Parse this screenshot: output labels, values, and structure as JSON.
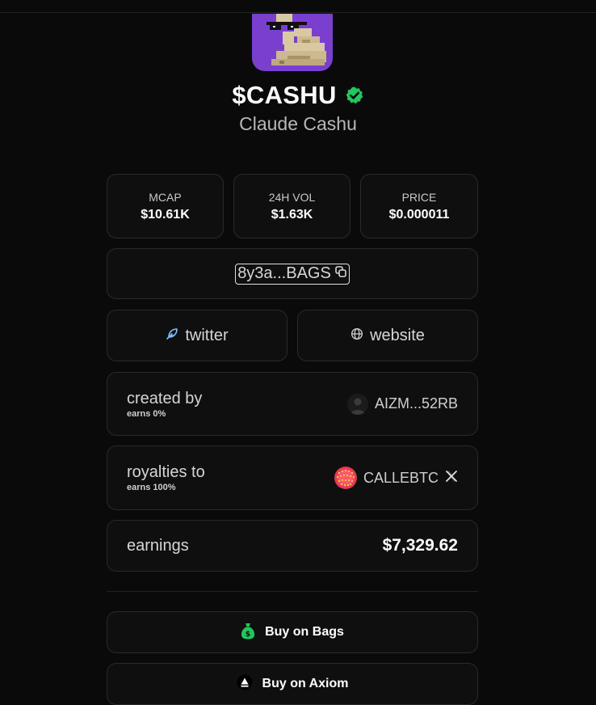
{
  "token": {
    "ticker": "$CASHU",
    "name": "Claude Cashu",
    "logo_bg": "#7b3fd0",
    "verified_color": "#22c55e"
  },
  "stats": [
    {
      "label": "MCAP",
      "value": "$10.61K"
    },
    {
      "label": "24H VOL",
      "value": "$1.63K"
    },
    {
      "label": "PRICE",
      "value": "$0.000011"
    }
  ],
  "contract": {
    "address_short": "8y3a...BAGS",
    "copy_icon": "copy-icon"
  },
  "links": {
    "twitter_label": "twitter",
    "twitter_icon": "feather-icon",
    "website_label": "website",
    "website_icon": "globe-icon"
  },
  "creator": {
    "label": "created by",
    "sub": "earns 0%",
    "user": "AIZM...52RB"
  },
  "royalties": {
    "label": "royalties to",
    "sub": "earns 100%",
    "user": "CALLEBTC",
    "social_icon": "x-icon"
  },
  "earnings": {
    "label": "earnings",
    "value": "$7,329.62"
  },
  "actions": {
    "buy_bags": "Buy on Bags",
    "buy_axiom": "Buy on Axiom"
  }
}
